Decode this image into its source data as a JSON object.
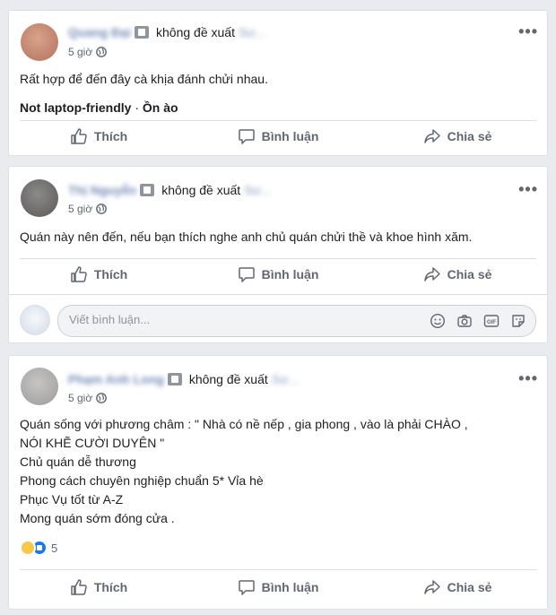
{
  "actions": {
    "like": "Thích",
    "comment": "Bình luận",
    "share": "Chia sẻ"
  },
  "posts": [
    {
      "author": "Quang Đại",
      "verb": "không đề xuất",
      "page": "Sư...",
      "time": "5 giờ",
      "text": "Rất hợp để đến đây cà khịa đánh chửi nhau.",
      "tags": {
        "t1": "Not laptop-friendly",
        "sep": " · ",
        "t2": "Ồn ào"
      }
    },
    {
      "author": "Thị Nguyễn",
      "verb": "không đề xuất",
      "page": "Sư...",
      "time": "5 giờ",
      "text": "Quán này nên đến, nếu bạn thích nghe anh chủ quán chửi thề và khoe hình xăm.",
      "comment_placeholder": "Viết bình luận..."
    },
    {
      "author": "Phạm Anh Long",
      "verb": "không đề xuất",
      "page": "Sư...",
      "time": "5 giờ",
      "lines": [
        "Quán sống với phương châm : \" Nhà có nề nếp , gia phong , vào là phải CHÀO ,",
        "NÓI KHẼ CƯỜI DUYÊN \"",
        "Chủ quán dễ thương",
        "Phong cách chuyên nghiệp chuẩn 5* Vỉa hè",
        "Phục Vụ tốt từ A-Z",
        "Mong quán sớm đóng cửa ."
      ],
      "reaction_count": "5"
    }
  ]
}
